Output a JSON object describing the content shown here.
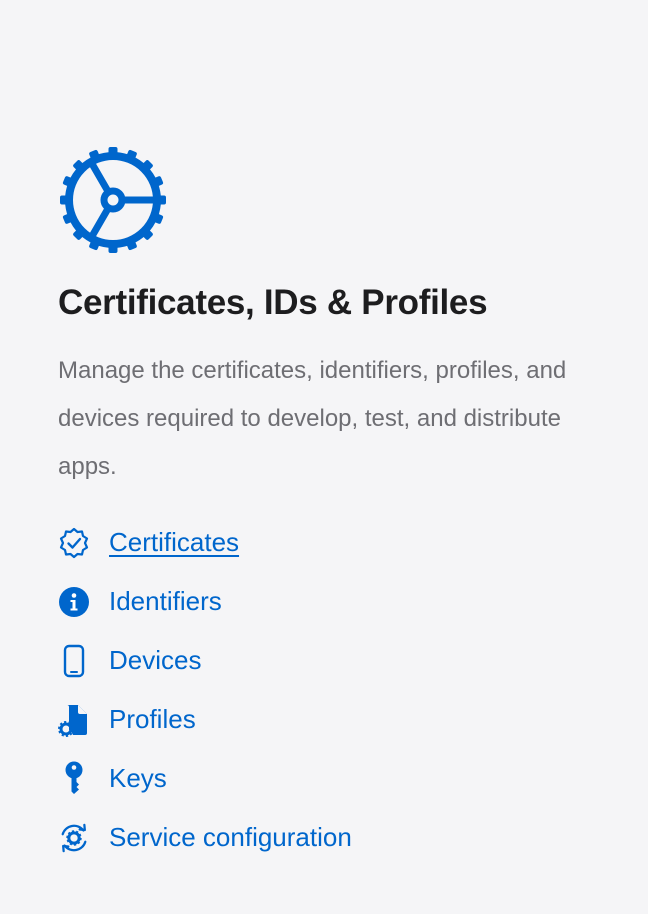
{
  "accent_color": "#0066cc",
  "hero": {
    "icon": "gear-icon",
    "title": "Certificates, IDs & Profiles",
    "description": "Manage the certificates, identifiers, profiles, and devices required to develop, test, and distribute apps."
  },
  "links": [
    {
      "label": "Certificates",
      "icon": "certificate-badge-icon"
    },
    {
      "label": "Identifiers",
      "icon": "info-circle-icon"
    },
    {
      "label": "Devices",
      "icon": "phone-icon"
    },
    {
      "label": "Profiles",
      "icon": "profile-document-gear-icon"
    },
    {
      "label": "Keys",
      "icon": "key-icon"
    },
    {
      "label": "Service configuration",
      "icon": "service-gear-icon"
    }
  ]
}
